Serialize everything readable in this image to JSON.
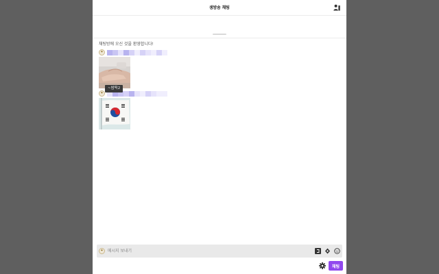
{
  "header": {
    "title": "생방송 채팅",
    "user_list_icon": "user-list-icon"
  },
  "messages": {
    "welcome": "채팅방에 오신 것을 환영합니다!",
    "items": [
      {
        "badge_icon": "subscriber-badge-icon",
        "nickname": "",
        "content": "image",
        "image_subject": "hands"
      },
      {
        "badge_icon": "subscriber-badge-icon",
        "nickname": "",
        "content": "image",
        "image_subject": "korean-flag"
      }
    ],
    "tooltip": "~밤떡2"
  },
  "composer": {
    "placeholder": "메시지 보내기",
    "icons": [
      "chat-mode-icon",
      "donation-icon",
      "emoji-icon"
    ],
    "settings_icon": "gear-icon",
    "send_label": "채팅"
  },
  "colors": {
    "accent": "#9148ee",
    "backdrop": "#5f5f5f",
    "input_bg": "#e9e9e9"
  }
}
